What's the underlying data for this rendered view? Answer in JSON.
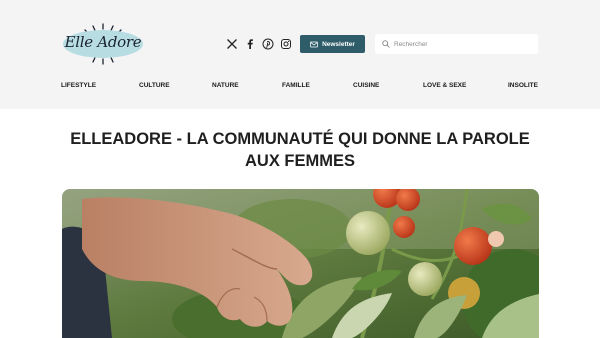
{
  "site": {
    "logo_text": "Elle Adore",
    "logo_icon": "sun-burst-logo"
  },
  "header": {
    "social_icons": [
      "x-icon",
      "facebook-icon",
      "pinterest-icon",
      "instagram-icon"
    ],
    "newsletter_label": "Newsletter",
    "newsletter_icon": "mail-icon",
    "search_placeholder": "Rechercher",
    "search_icon": "search-icon"
  },
  "nav": {
    "items": [
      "LIFESTYLE",
      "CULTURE",
      "NATURE",
      "FAMILLE",
      "CUISINE",
      "LOVE & SEXE",
      "INSOLITE"
    ]
  },
  "article": {
    "headline": "ELLEADORE - LA COMMUNAUTÉ QUI DONNE LA PAROLE AUX FEMMES",
    "hero_description_icon": "hand-tomato-plant-photo"
  },
  "colors": {
    "topbar_bg": "#f4f4f4",
    "logo_bg": "#b7dde3",
    "accent": "#2e5c68",
    "text": "#1a1a1a"
  }
}
